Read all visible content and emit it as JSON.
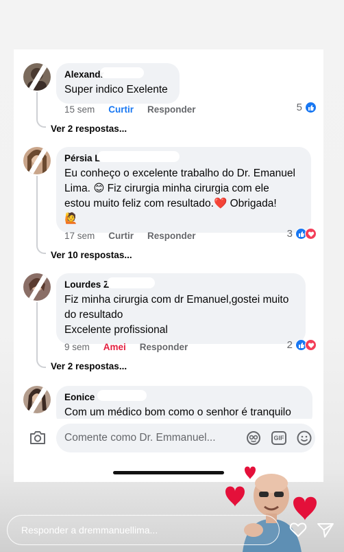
{
  "comments": [
    {
      "author": "Alexandr",
      "text": [
        "Super indico Exelente"
      ],
      "time": "15 sem",
      "action_like": "Curtir",
      "action_reply": "Responder",
      "reaction_count": "5",
      "view_replies": "Ver 2 respostas..."
    },
    {
      "author": "Pérsia L",
      "text": [
        "Eu conheço o excelente trabalho do Dr. Emanuel",
        "Lima. 😊 Fiz cirurgia minha cirurgia com ele",
        "estou muito feliz com resultado.❤️ Obrigada!",
        "🙋"
      ],
      "time": "17 sem",
      "action_like": "Curtir",
      "action_reply": "Responder",
      "reaction_count": "3",
      "view_replies": "Ver 10 respostas..."
    },
    {
      "author": "Lourdes Z",
      "text": [
        "Fiz minha cirurgia com dr Emanuel,gostei muito",
        "do resultado",
        "Excelente  profissional"
      ],
      "time": "9 sem",
      "action_like": "Amei",
      "action_reply": "Responder",
      "reaction_count": "2",
      "view_replies": "Ver 2 respostas..."
    },
    {
      "author": "Eonice",
      "text": [
        "Com um médico bom como o senhor é tranquilo"
      ]
    }
  ],
  "composer": {
    "placeholder": "Comente como Dr. Emmanuel...",
    "gif_label": "GIF"
  },
  "story_reply": {
    "placeholder": "Responder a dremmanuellima..."
  },
  "colors": {
    "like_blue": "#1877f2",
    "love_red": "#e41e3f",
    "bubble_gray": "#f0f2f5"
  },
  "icons": [
    "camera-icon",
    "avatar-sticker-icon",
    "gif-icon",
    "emoji-icon",
    "heart-icon",
    "send-icon"
  ]
}
